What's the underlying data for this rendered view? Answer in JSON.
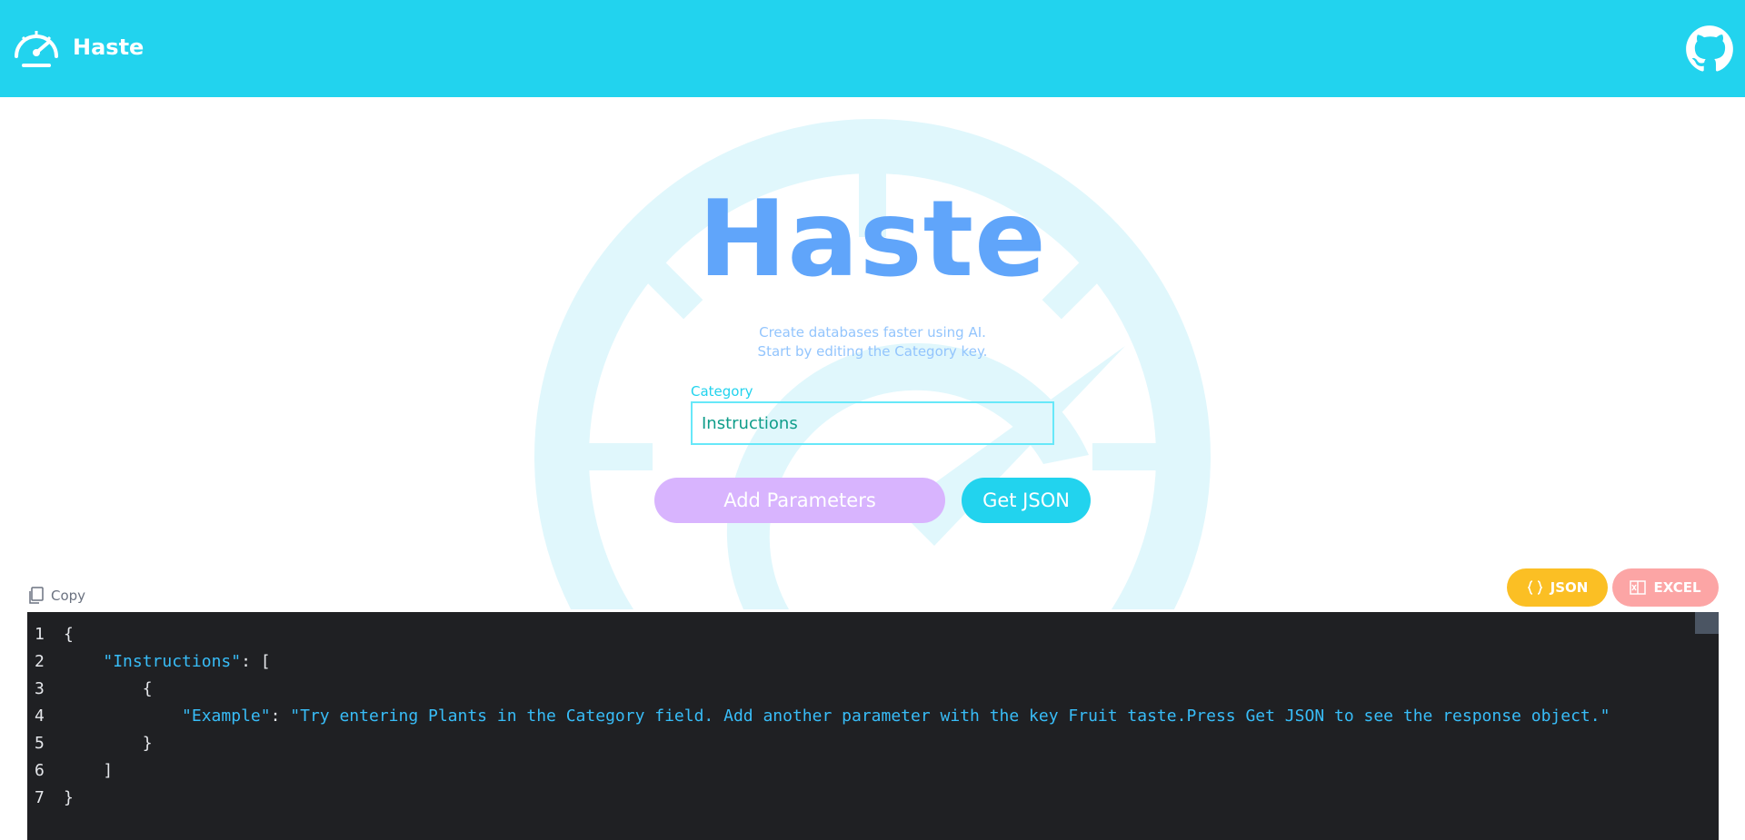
{
  "header": {
    "app_name": "Haste"
  },
  "hero": {
    "title": "Haste",
    "subtitle_line1": "Create databases faster using AI.",
    "subtitle_line2": "Start by editing the Category key."
  },
  "form": {
    "category_label": "Category",
    "category_value": "Instructions",
    "add_parameters_label": "Add Parameters",
    "get_json_label": "Get JSON"
  },
  "output": {
    "copy_label": "Copy",
    "json_tab_label": "JSON",
    "excel_tab_label": "EXCEL",
    "line_numbers": [
      "1",
      "2",
      "3",
      "4",
      "5",
      "6",
      "7"
    ],
    "key_instructions": "\"Instructions\"",
    "key_example": "\"Example\"",
    "value_example": "\"Try entering Plants in the Category field. Add another parameter with the key Fruit taste.Press Get JSON to see the response object.\""
  },
  "colors": {
    "topbar": "#22d3ee",
    "hero_title": "#60a5fa",
    "add_button": "#d8b4fe",
    "get_button": "#22d3ee",
    "json_tab": "#fbbf24",
    "excel_tab": "#fca5a5",
    "editor_bg": "#1f2023",
    "json_string": "#38bdf8"
  },
  "icons": [
    "speedometer-logo-icon",
    "github-icon",
    "copy-icon",
    "braces-icon",
    "excel-icon"
  ]
}
